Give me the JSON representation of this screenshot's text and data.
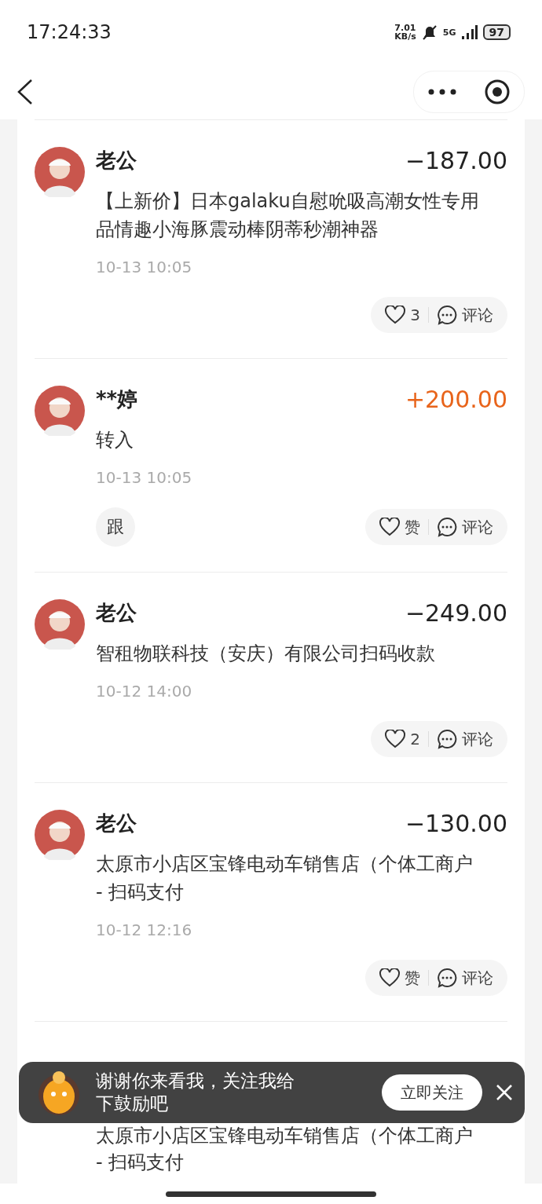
{
  "status_bar": {
    "time": "17:24:33",
    "speed_value": "7.01",
    "speed_unit": "KB/s",
    "network": "5G",
    "battery": "97"
  },
  "entries": [
    {
      "name": "老公",
      "amount": "−187.00",
      "kind": "expense",
      "description": "【上新价】日本galaku自慰吮吸高潮女性专用品情趣小海豚震动棒阴蒂秒潮神器",
      "time": "10-13 10:05",
      "like": "3",
      "comment": "评论"
    },
    {
      "name": "**婷",
      "amount": "+200.00",
      "kind": "income",
      "description": "转入",
      "time": "10-13 10:05",
      "follow": "跟",
      "like": "赞",
      "comment": "评论"
    },
    {
      "name": "老公",
      "amount": "−249.00",
      "kind": "expense",
      "description": "智租物联科技（安庆）有限公司扫码收款",
      "time": "10-12 14:00",
      "like": "2",
      "comment": "评论"
    },
    {
      "name": "老公",
      "amount": "−130.00",
      "kind": "expense",
      "description": "太原市小店区宝锋电动车销售店（个体工商户 - 扫码支付",
      "time": "10-12 12:16",
      "like": "赞",
      "comment": "评论"
    },
    {
      "description": "太原市小店区宝锋电动车销售店（个体工商户 - 扫码支付"
    }
  ],
  "toast": {
    "message": "谢谢你来看我，关注我给下鼓励吧",
    "button": "立即关注"
  }
}
